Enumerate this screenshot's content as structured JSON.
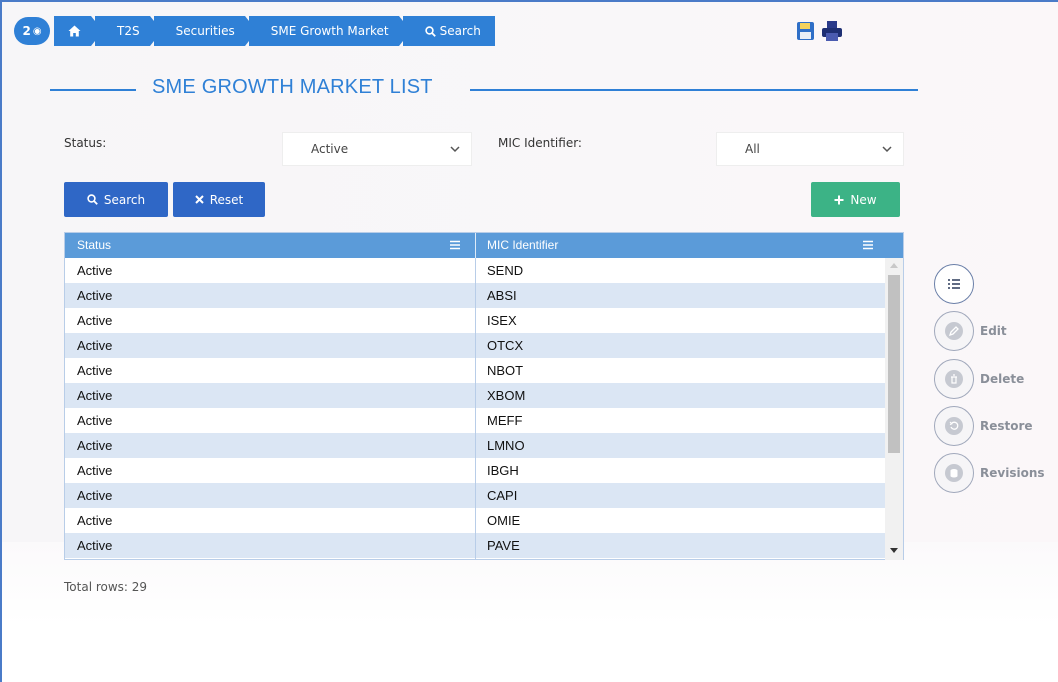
{
  "breadcrumb": {
    "badge_count": "2",
    "items": [
      "T2S",
      "Securities",
      "SME Growth Market"
    ],
    "search_label": "Search"
  },
  "page": {
    "title": "SME GROWTH MARKET LIST"
  },
  "filters": {
    "status_label": "Status:",
    "status_value": "Active",
    "mic_label": "MIC Identifier:",
    "mic_value": "All"
  },
  "buttons": {
    "search": "Search",
    "reset": "Reset",
    "new": "New"
  },
  "table": {
    "columns": [
      "Status",
      "MIC Identifier"
    ],
    "rows": [
      [
        "Active",
        "SEND"
      ],
      [
        "Active",
        "ABSI"
      ],
      [
        "Active",
        "ISEX"
      ],
      [
        "Active",
        "OTCX"
      ],
      [
        "Active",
        "NBOT"
      ],
      [
        "Active",
        "XBOM"
      ],
      [
        "Active",
        "MEFF"
      ],
      [
        "Active",
        "LMNO"
      ],
      [
        "Active",
        "IBGH"
      ],
      [
        "Active",
        "CAPI"
      ],
      [
        "Active",
        "OMIE"
      ],
      [
        "Active",
        "PAVE"
      ]
    ]
  },
  "footer": {
    "total_rows": "Total rows: 29"
  },
  "side_actions": {
    "edit": "Edit",
    "delete": "Delete",
    "restore": "Restore",
    "revisions": "Revisions"
  },
  "colors": {
    "primary": "#2f80d6",
    "button_blue": "#2f67c6",
    "button_green": "#3cb386",
    "table_header": "#5b9bd9",
    "row_alt": "#dbe6f4"
  },
  "icons": [
    "eye-icon",
    "home-icon",
    "search-icon",
    "save-icon",
    "print-icon",
    "close-icon",
    "plus-icon",
    "column-menu-icon",
    "list-icon",
    "edit-icon",
    "trash-icon",
    "restore-icon",
    "database-icon"
  ]
}
